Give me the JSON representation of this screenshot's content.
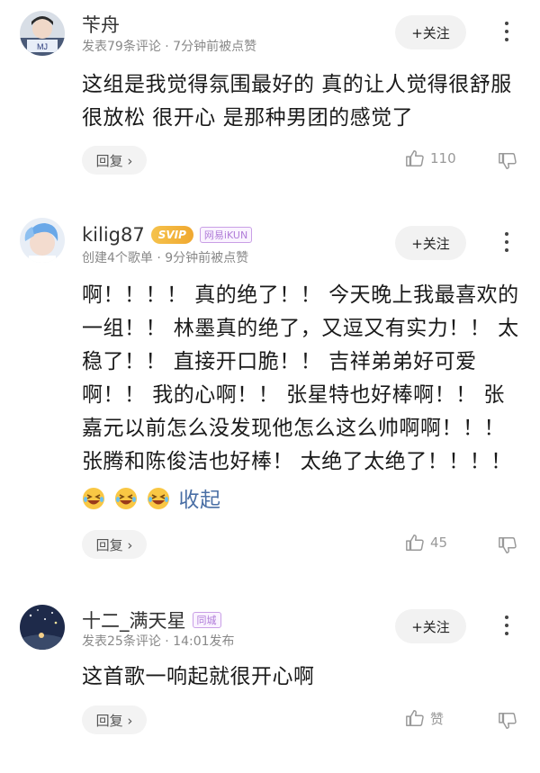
{
  "comments": [
    {
      "username": "苄舟",
      "meta": "发表79条评论 · 7分钟前被点赞",
      "follow_label": "+关注",
      "text": "这组是我觉得氛围最好的 真的让人觉得很舒服 很放松 很开心 是那种男团的感觉了",
      "reply_label": "回复 ›",
      "like_count": "110",
      "avatar_icon": "avatar-photo-icon"
    },
    {
      "username": "kilig87",
      "vip_label": "SVIP",
      "tag_label": "网易iKUN",
      "meta": "创建4个歌单 · 9分钟前被点赞",
      "follow_label": "+关注",
      "text": "啊！！！！ 真的绝了！！ 今天晚上我最喜欢的一组！！ 林墨真的绝了，又逗又有实力！！ 太稳了！！ 直接开口脆！！ 吉祥弟弟好可爱啊！！ 我的心啊！！ 张星特也好棒啊！！ 张嘉元以前怎么没发现他怎么这么帅啊啊！！！ 张腾和陈俊洁也好棒！ 太绝了太绝了！！！！",
      "collapse_label": "收起",
      "reply_label": "回复 ›",
      "like_count": "45",
      "avatar_icon": "avatar-photo-icon"
    },
    {
      "username": "十二_满天星",
      "tag_label": "同城",
      "meta": "发表25条评论 · 14:01发布",
      "follow_label": "+关注",
      "text": "这首歌一响起就很开心啊",
      "reply_label": "回复 ›",
      "like_count": "赞",
      "avatar_icon": "avatar-photo-icon"
    }
  ],
  "colors": {
    "accent_link": "#4a6fa5",
    "vip_gold": "#f0a830",
    "tag_purple": "#b07cd8"
  }
}
